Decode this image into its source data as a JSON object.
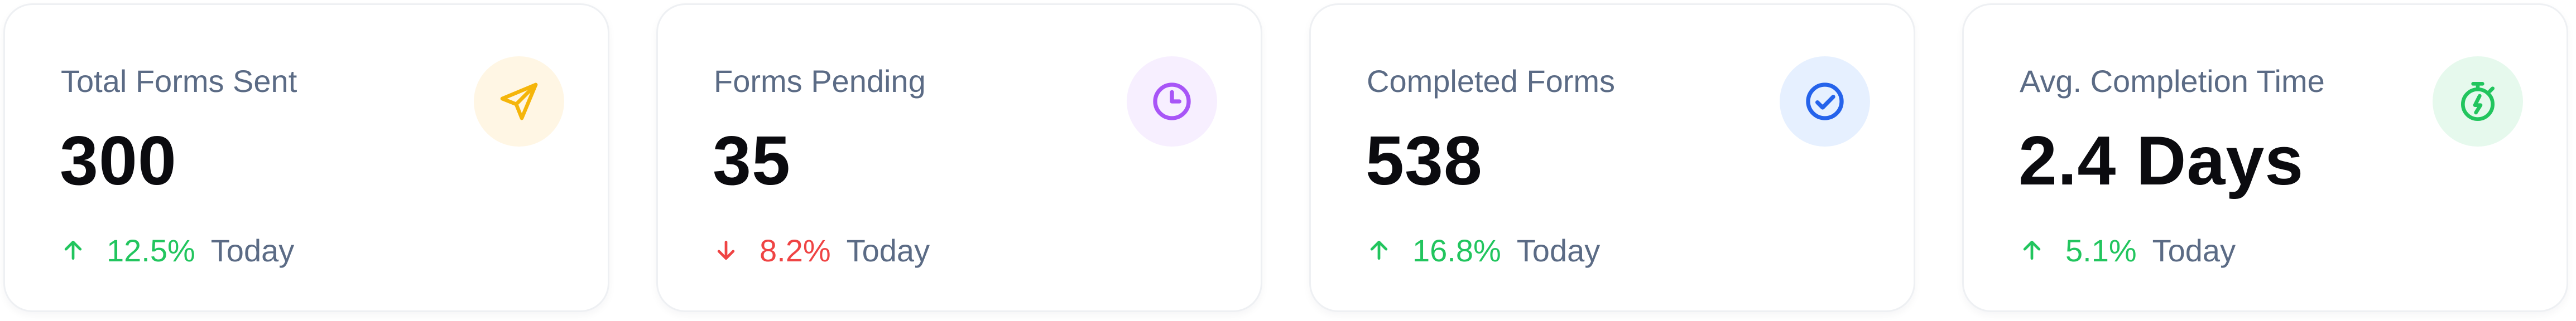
{
  "cards": [
    {
      "title": "Total Forms Sent",
      "value": "300",
      "trend_direction": "up",
      "trend_percent": "12.5%",
      "trend_period": "Today",
      "icon": "send-icon",
      "icon_color": "#f5b50a",
      "icon_bg": "#fff6e4"
    },
    {
      "title": "Forms Pending",
      "value": "35",
      "trend_direction": "down",
      "trend_percent": "8.2%",
      "trend_period": "Today",
      "icon": "clock-icon",
      "icon_color": "#a855f7",
      "icon_bg": "#f7efff"
    },
    {
      "title": "Completed Forms",
      "value": "538",
      "trend_direction": "up",
      "trend_percent": "16.8%",
      "trend_period": "Today",
      "icon": "check-circle-icon",
      "icon_color": "#2563eb",
      "icon_bg": "#e6f0ff"
    },
    {
      "title": "Avg. Completion Time",
      "value": "2.4 Days",
      "trend_direction": "up",
      "trend_percent": "5.1%",
      "trend_period": "Today",
      "icon": "stopwatch-icon",
      "icon_color": "#22c55e",
      "icon_bg": "#e6f9ed"
    }
  ],
  "colors": {
    "trend_up": "#22c55e",
    "trend_down": "#ef4444",
    "label": "#5b6b85",
    "value": "#0b0b0f"
  }
}
